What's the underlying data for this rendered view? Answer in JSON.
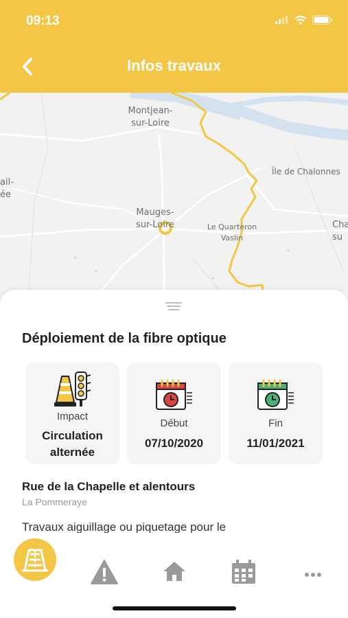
{
  "status_bar": {
    "time": "09:13"
  },
  "header": {
    "title": "Infos travaux",
    "back_icon": "chevron-left-icon"
  },
  "map": {
    "labels": {
      "montjean": "Montjean-\nsur-Loire",
      "ile": "Île de Chalonnes",
      "mauges": "Mauges-\nsur-Loire",
      "quarteron": "Le Quarteron\nVaslin",
      "left_edge": "ail-\née",
      "right_edge": "Cha\nsu"
    },
    "colors": {
      "route": "#f4c645",
      "river": "#cfe0ee",
      "marker": "#f4c645"
    }
  },
  "sheet": {
    "title": "Déploiement de la fibre optique",
    "cards": [
      {
        "icon": "traffic-cone-light-icon",
        "label": "Impact",
        "value": "Circulation\nalternée"
      },
      {
        "icon": "calendar-red-clock-icon",
        "label": "Début",
        "value": "07/10/2020"
      },
      {
        "icon": "calendar-green-clock-icon",
        "label": "Fin",
        "value": "11/01/2021"
      }
    ],
    "street": "Rue de la Chapelle et alentours",
    "commune": "La Pommeraye",
    "description": "Travaux aiguillage ou piquetage pour le"
  },
  "tabbar": {
    "items": [
      {
        "icon": "roadworks-icon",
        "active": true
      },
      {
        "icon": "warning-icon",
        "active": false
      },
      {
        "icon": "home-icon",
        "active": false
      },
      {
        "icon": "calendar-icon",
        "active": false
      },
      {
        "icon": "more-icon",
        "active": false
      }
    ],
    "active_color": "#f4c645",
    "inactive_color": "#9a9a9a"
  }
}
